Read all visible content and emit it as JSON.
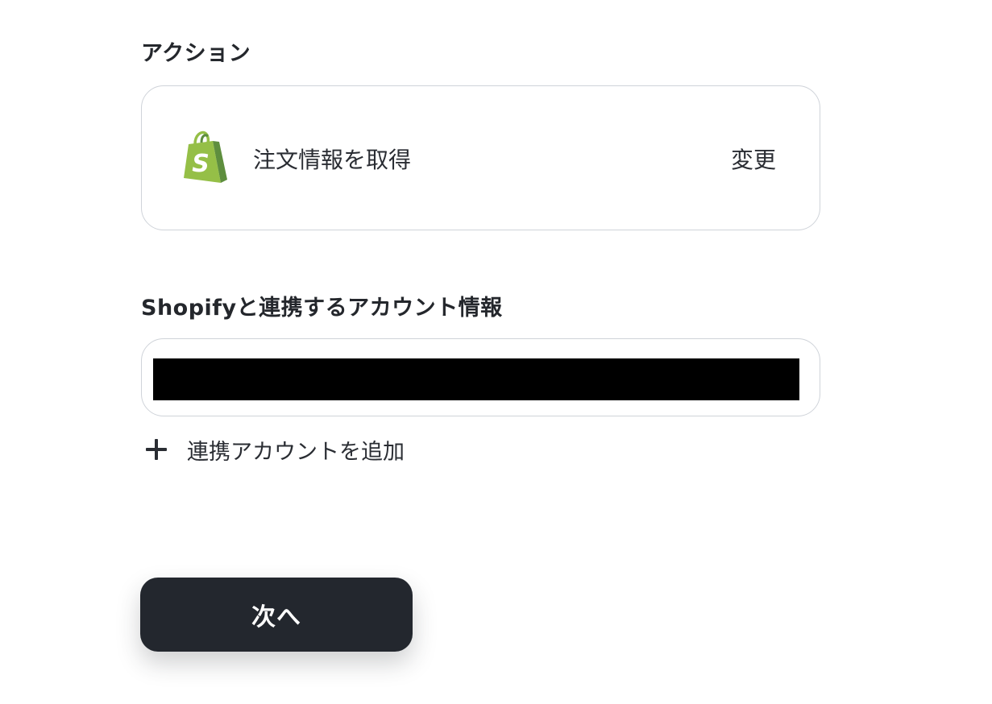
{
  "action_section": {
    "label": "アクション",
    "action_name": "注文情報を取得",
    "change_label": "変更",
    "app_icon": "shopify-bag-icon"
  },
  "account_section": {
    "label": "Shopifyと連携するアカウント情報",
    "add_account_label": "連携アカウントを追加",
    "add_icon": "plus-icon"
  },
  "next_button_label": "次へ",
  "colors": {
    "shopify_green": "#95bf47",
    "shopify_dark_green": "#5e8e3e",
    "button_bg": "#23272e",
    "border": "#cfd3d9"
  }
}
